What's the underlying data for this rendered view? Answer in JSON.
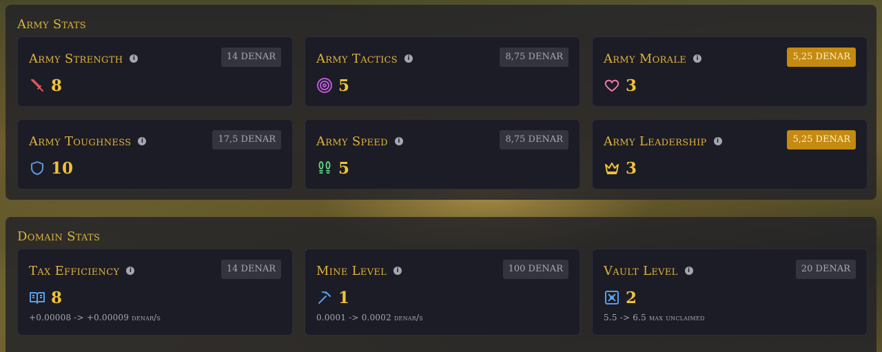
{
  "army": {
    "title": "Army Stats",
    "cards": [
      {
        "title": "Army Strength",
        "cost": "14 DENAR",
        "value": "8",
        "icon": "sword-icon",
        "icon_color": "#e05a5a",
        "affordable": false
      },
      {
        "title": "Army Tactics",
        "cost": "8,75 DENAR",
        "value": "5",
        "icon": "target-icon",
        "icon_color": "#c05ae0",
        "affordable": false
      },
      {
        "title": "Army Morale",
        "cost": "5,25 DENAR",
        "value": "3",
        "icon": "heart-icon",
        "icon_color": "#f07aa8",
        "affordable": true
      },
      {
        "title": "Army Toughness",
        "cost": "17,5 DENAR",
        "value": "10",
        "icon": "shield-icon",
        "icon_color": "#5a9ae0",
        "affordable": false
      },
      {
        "title": "Army Speed",
        "cost": "8,75 DENAR",
        "value": "5",
        "icon": "footprints-icon",
        "icon_color": "#5ad07a",
        "affordable": false
      },
      {
        "title": "Army Leadership",
        "cost": "5,25 DENAR",
        "value": "3",
        "icon": "crown-icon",
        "icon_color": "#f0c23a",
        "affordable": true
      }
    ]
  },
  "domain": {
    "title": "Domain Stats",
    "cards": [
      {
        "title": "Tax Efficiency",
        "cost": "14 DENAR",
        "value": "8",
        "sub": "+0.00008 -> +0.00009 denar/s",
        "icon": "book-icon",
        "icon_color": "#5aa0f0"
      },
      {
        "title": "Mine Level",
        "cost": "100 DENAR",
        "value": "1",
        "sub": "0.0001 -> 0.0002 denar/s",
        "icon": "pickaxe-icon",
        "icon_color": "#5aa0f0"
      },
      {
        "title": "Vault Level",
        "cost": "20 DENAR",
        "value": "2",
        "sub": "5.5 -> 6.5 max unclaimed",
        "icon": "vault-icon",
        "icon_color": "#5aa0f0"
      }
    ]
  },
  "colors": {
    "accent": "#e0b43a",
    "affordable_badge": "#c58a10"
  }
}
